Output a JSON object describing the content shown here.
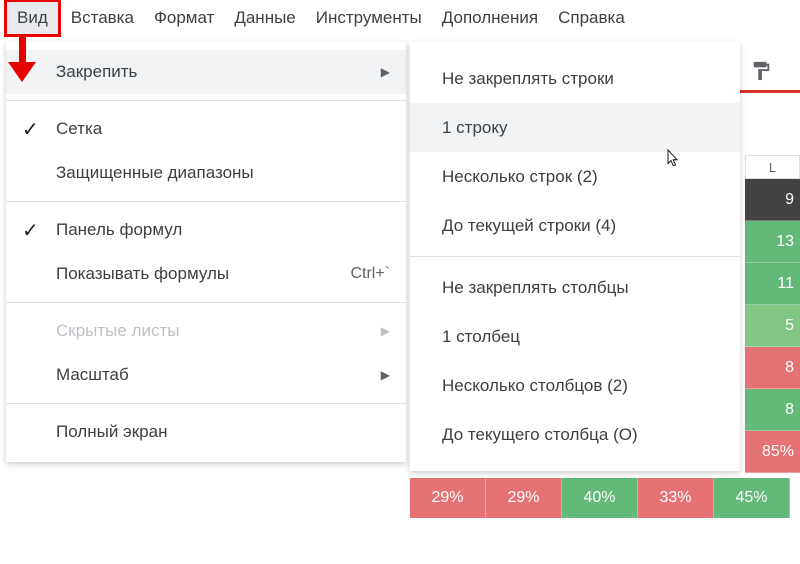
{
  "menubar": {
    "items": [
      "Вид",
      "Вставка",
      "Формат",
      "Данные",
      "Инструменты",
      "Дополнения",
      "Справка"
    ]
  },
  "view_menu": {
    "freeze": "Закрепить",
    "grid": "Сетка",
    "protected": "Защищенные диапазоны",
    "formula_bar": "Панель формул",
    "show_formulas": "Показывать формулы",
    "show_formulas_shortcut": "Ctrl+`",
    "hidden_sheets": "Скрытые листы",
    "zoom": "Масштаб",
    "fullscreen": "Полный экран"
  },
  "freeze_submenu": {
    "no_rows": "Не закреплять строки",
    "one_row": "1 строку",
    "several_rows": "Несколько строк (2)",
    "upto_row": "До текущей строки (4)",
    "no_cols": "Не закреплять столбцы",
    "one_col": "1 столбец",
    "several_cols": "Несколько столбцов (2)",
    "upto_col": "До текущего столбца (O)"
  },
  "sheet": {
    "col": "L",
    "cells": [
      "9",
      "13",
      "11",
      "5",
      "8",
      "8",
      "85%"
    ],
    "bottom_row": [
      "29%",
      "29%",
      "40%",
      "33%",
      "45%"
    ]
  }
}
